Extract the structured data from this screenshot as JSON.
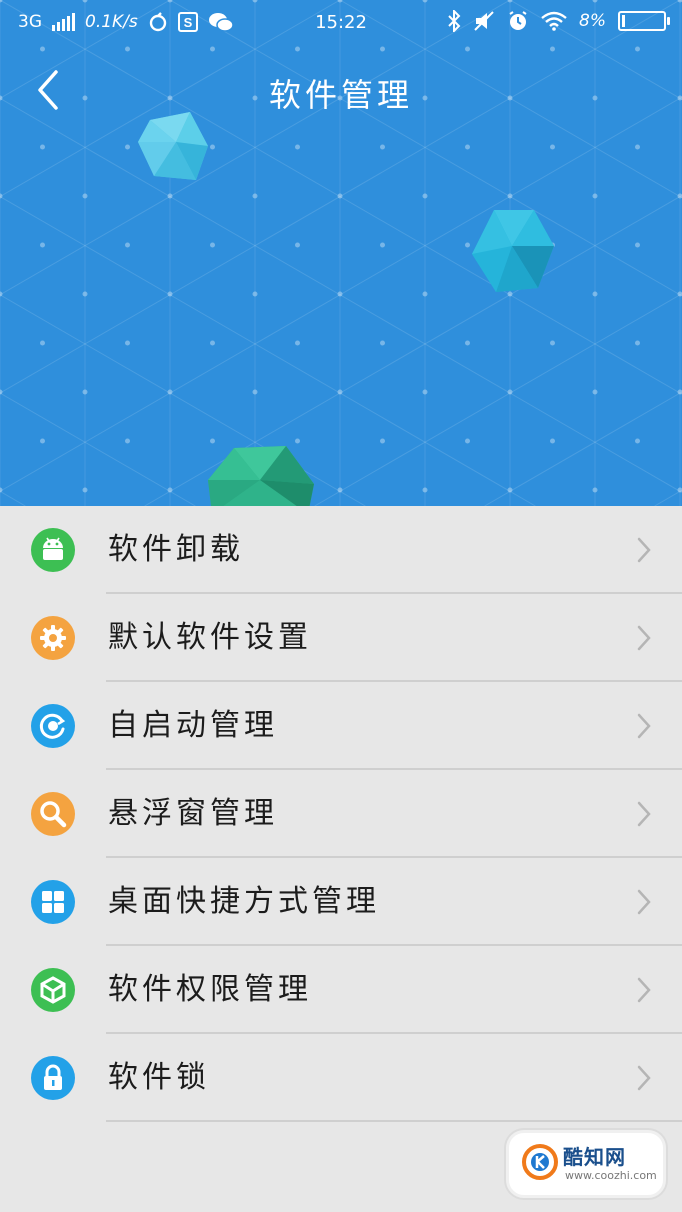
{
  "status_bar": {
    "network": "3G",
    "speed": "0.1K/s",
    "time": "15:22",
    "battery": "8%",
    "battery_level": 0.08
  },
  "header": {
    "title": "软件管理",
    "background_color": "#2f8fdc"
  },
  "menu": {
    "items": [
      {
        "label": "软件卸载",
        "icon": "android-icon",
        "color": "#3dbf53"
      },
      {
        "label": "默认软件设置",
        "icon": "gear-icon",
        "color": "#f4a340"
      },
      {
        "label": "自启动管理",
        "icon": "power-cycle-icon",
        "color": "#23a1e8"
      },
      {
        "label": "悬浮窗管理",
        "icon": "wrench-icon",
        "color": "#f4a340"
      },
      {
        "label": "桌面快捷方式管理",
        "icon": "grid-icon",
        "color": "#23a1e8"
      },
      {
        "label": "软件权限管理",
        "icon": "shield-check-icon",
        "color": "#3dbf53"
      },
      {
        "label": "软件锁",
        "icon": "lock-icon",
        "color": "#23a1e8"
      }
    ]
  },
  "watermark": {
    "name": "酷知网",
    "url": "www.coozhi.com"
  }
}
